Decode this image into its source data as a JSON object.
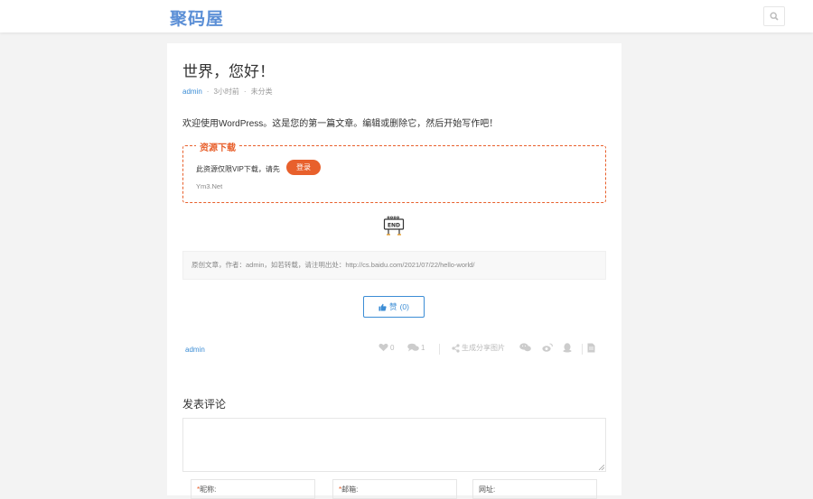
{
  "header": {
    "logo": "聚码屋",
    "search_icon": "search-icon"
  },
  "post": {
    "title": "世界，您好！",
    "meta": {
      "author": "admin",
      "time": "3小时前",
      "category": "未分类"
    },
    "intro": "欢迎使用WordPress。这是您的第一篇文章。编辑或删除它，然后开始写作吧！",
    "download": {
      "legend": "资源下载",
      "text": "此资源仅限VIP下载，请先",
      "login_label": "登录",
      "site": "Ym3.Net",
      "accent_color": "#e8602c"
    },
    "end_icon": "end-sign-icon",
    "copyright": "原创文章，作者：admin，如若转载，请注明出处：http://cs.baidu.com/2021/07/22/hello-world/",
    "like": {
      "label": "赞",
      "count": "(0)"
    },
    "footer": {
      "author": "admin",
      "likes": "0",
      "comments": "1",
      "share_label": "生成分享图片"
    }
  },
  "comment": {
    "title": "发表评论",
    "fields": {
      "name_label": "昵称:",
      "email_label": "邮箱:",
      "url_label": "网址:"
    }
  },
  "colors": {
    "link": "#3c8dd5",
    "logo": "#5b8fd6"
  }
}
